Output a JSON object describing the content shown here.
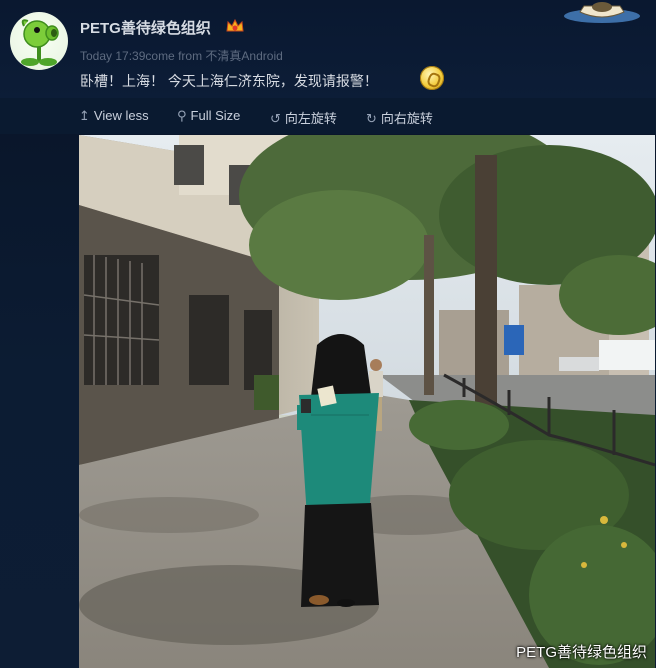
{
  "post": {
    "username": "PETG善待绿色组织",
    "timestamp": "Today 17:39",
    "source_prefix": "come from",
    "source": "不清真Android",
    "text": "卧槽！上海！ 今天上海仁济东院，发现请报警！",
    "badge_icon": "vip-crown-icon",
    "emoji_icon": "smiley-emoji-icon"
  },
  "toolbar": {
    "items": [
      {
        "label": "View less",
        "icon": "collapse-up-icon"
      },
      {
        "label": "Full Size",
        "icon": "magnify-icon"
      },
      {
        "label": "向左旋转",
        "icon": "rotate-left-icon"
      },
      {
        "label": "向右旋转",
        "icon": "rotate-right-icon"
      }
    ]
  },
  "photo": {
    "watermark": "PETG善待绿色组织",
    "description_icon": "street-photo"
  },
  "colors": {
    "background": "#0b1a30",
    "text_primary": "#d8dce3",
    "text_meta": "#5e6b80"
  }
}
